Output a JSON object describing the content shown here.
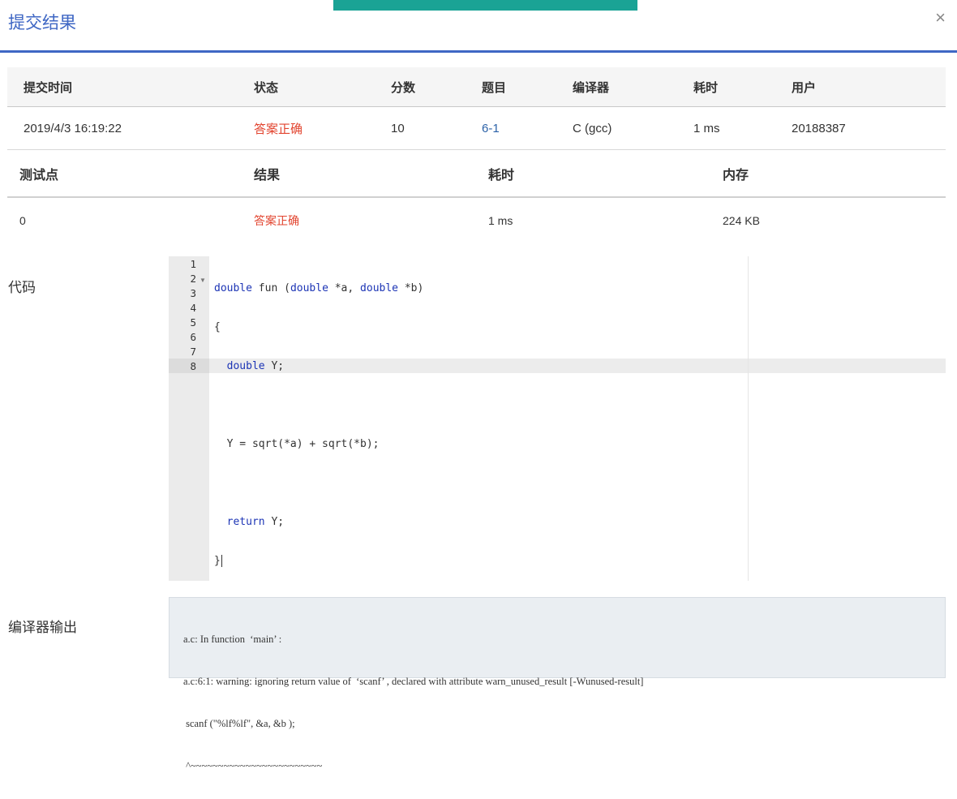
{
  "dialog": {
    "title": "提交结果",
    "close": "×"
  },
  "summary": {
    "headers": [
      "提交时间",
      "状态",
      "分数",
      "题目",
      "编译器",
      "耗时",
      "用户"
    ],
    "row": {
      "time": "2019/4/3 16:19:22",
      "status": "答案正确",
      "score": "10",
      "problem": "6-1",
      "compiler": "C (gcc)",
      "duration": "1 ms",
      "user": "20188387"
    }
  },
  "tests": {
    "headers": [
      "测试点",
      "结果",
      "耗时",
      "内存"
    ],
    "rows": [
      {
        "id": "0",
        "result": "答案正确",
        "time": "1 ms",
        "memory": "224 KB"
      }
    ]
  },
  "code_section": {
    "label": "代码",
    "line_numbers": [
      "1",
      "2",
      "3",
      "4",
      "5",
      "6",
      "7",
      "8"
    ],
    "lines": [
      "double fun (double *a, double *b)",
      "{",
      "  double Y;",
      "",
      "  Y = sqrt(*a) + sqrt(*b);",
      "",
      "  return Y;",
      "}"
    ]
  },
  "compiler_section": {
    "label": "编译器输出",
    "lines": [
      "a.c: In function  ‘main’ :",
      "a.c:6:1: warning: ignoring return value of  ‘scanf’ , declared with attribute warn_unused_result [-Wunused-result]",
      " scanf (\"%lf%lf\", &a, &b );",
      " ^~~~~~~~~~~~~~~~~~~~~~~~~"
    ]
  },
  "colors": {
    "accent": "#3f67c4",
    "top_bar": "#1aa395",
    "status_ok": "#e2442f",
    "link": "#2c62a8",
    "keyword": "#1c34b5"
  }
}
